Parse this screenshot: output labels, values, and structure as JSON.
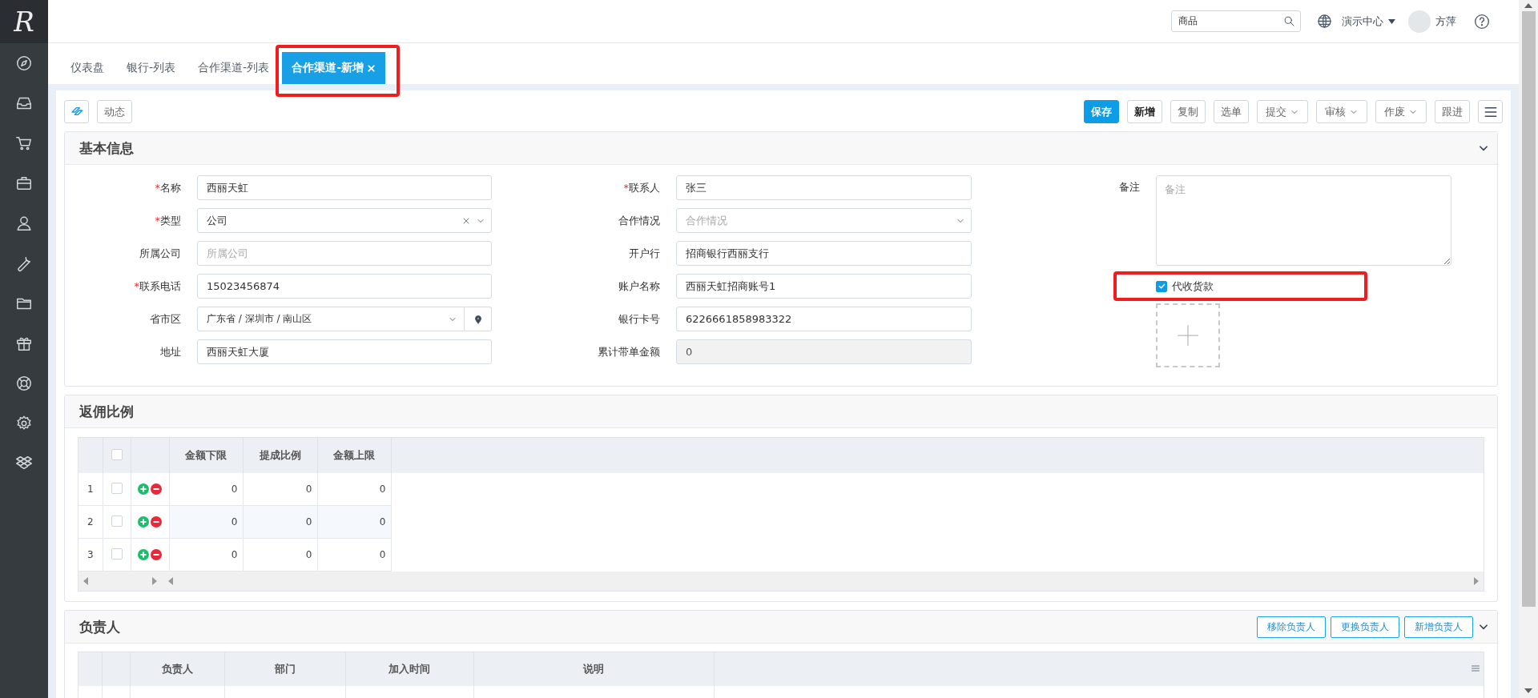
{
  "sidebar": {
    "logo": "R",
    "items": [
      {
        "kind": "compass"
      },
      {
        "kind": "inbox"
      },
      {
        "kind": "cart"
      },
      {
        "kind": "briefcase"
      },
      {
        "kind": "user"
      },
      {
        "kind": "wrench"
      },
      {
        "kind": "folder"
      },
      {
        "kind": "gift"
      },
      {
        "kind": "lifebuoy"
      },
      {
        "kind": "gear"
      },
      {
        "kind": "boxes"
      }
    ]
  },
  "topbar": {
    "search": {
      "value": "商品"
    },
    "org": "演示中心",
    "user": "方萍"
  },
  "tabs": [
    {
      "label": "仪表盘",
      "selected": false,
      "closable": false,
      "highlighted": false
    },
    {
      "label": "银行-列表",
      "selected": false,
      "closable": false,
      "highlighted": false
    },
    {
      "label": "合作渠道-列表",
      "selected": false,
      "closable": false,
      "highlighted": false
    },
    {
      "label": "合作渠道-新增",
      "selected": true,
      "closable": true,
      "highlighted": true
    }
  ],
  "toolbar": {
    "left": [
      {
        "kind": "icon"
      },
      {
        "kind": "text",
        "label": "动态"
      }
    ],
    "right": [
      {
        "kind": "primary",
        "label": "保存"
      },
      {
        "kind": "strong",
        "label": "新增"
      },
      {
        "kind": "plain",
        "label": "复制"
      },
      {
        "kind": "plain",
        "label": "选单"
      },
      {
        "kind": "dropdown",
        "label": "提交"
      },
      {
        "kind": "dropdown",
        "label": "审核"
      },
      {
        "kind": "dropdown",
        "label": "作废"
      },
      {
        "kind": "plain",
        "label": "跟进"
      },
      {
        "kind": "menu"
      }
    ]
  },
  "basic_info": {
    "title": "基本信息",
    "collapsible": true,
    "required_mark": "*",
    "left_fields": [
      {
        "label": "名称",
        "required": true,
        "kind": "text",
        "value": "西丽天虹"
      },
      {
        "label": "类型",
        "required": true,
        "kind": "select",
        "value": "公司",
        "clearable": true
      },
      {
        "label": "所属公司",
        "required": false,
        "kind": "text",
        "placeholder": "所属公司"
      },
      {
        "label": "联系电话",
        "required": true,
        "kind": "text",
        "value": "15023456874"
      },
      {
        "label": "省市区",
        "required": false,
        "kind": "region",
        "value": "广东省 / 深圳市 / 南山区"
      },
      {
        "label": "地址",
        "required": false,
        "kind": "text",
        "value": "西丽天虹大厦"
      }
    ],
    "middle_fields": [
      {
        "label": "联系人",
        "required": true,
        "kind": "text",
        "value": "张三"
      },
      {
        "label": "合作情况",
        "required": false,
        "kind": "select",
        "placeholder": "合作情况",
        "clearable": false
      },
      {
        "label": "开户行",
        "required": false,
        "kind": "text",
        "value": "招商银行西丽支行"
      },
      {
        "label": "账户名称",
        "required": false,
        "kind": "text",
        "value": "西丽天虹招商账号1"
      },
      {
        "label": "银行卡号",
        "required": false,
        "kind": "text",
        "value": "6226661858983322"
      },
      {
        "label": "累计带单金额",
        "required": false,
        "kind": "readonly",
        "value": "0"
      }
    ],
    "remark": {
      "label": "备注",
      "placeholder": "备注"
    },
    "cod": {
      "label": "代收货款",
      "checked": true,
      "highlighted": true
    }
  },
  "rebate": {
    "title": "返佣比例",
    "collapsible": false,
    "select_all": {
      "checked": false
    },
    "columns": [
      "金额下限",
      "提成比例",
      "金额上限"
    ],
    "rows": [
      {
        "index": "1",
        "checked": false,
        "values": [
          "0",
          "0",
          "0"
        ]
      },
      {
        "index": "2",
        "checked": false,
        "values": [
          "0",
          "0",
          "0"
        ]
      },
      {
        "index": "3",
        "checked": false,
        "values": [
          "0",
          "0",
          "0"
        ]
      }
    ]
  },
  "owners": {
    "title": "负责人",
    "collapsible": true,
    "buttons": [
      "移除负责人",
      "更换负责人",
      "新增负责人"
    ],
    "columns": [
      "负责人",
      "部门",
      "加入时间",
      "说明"
    ]
  }
}
